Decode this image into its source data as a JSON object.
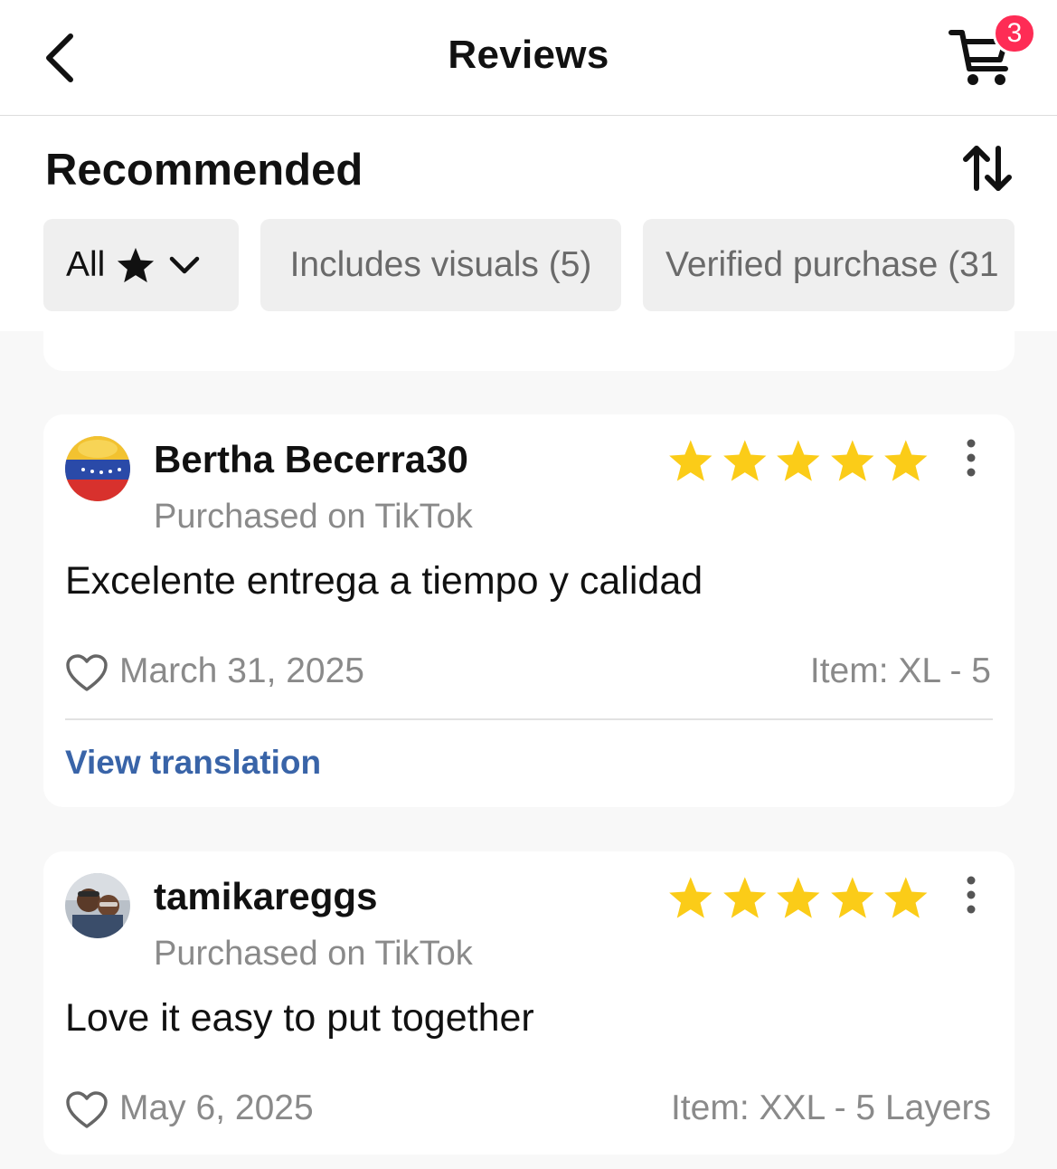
{
  "header": {
    "title": "Reviews",
    "cart_count": "3"
  },
  "sort": {
    "label": "Recommended"
  },
  "filters": {
    "all_label": "All",
    "visuals_label": "Includes visuals (5)",
    "verified_label": "Verified purchase (31"
  },
  "colors": {
    "star": "#fbcc18",
    "badge": "#fe2c55",
    "link": "#3964a8"
  },
  "reviews": [
    {
      "username": "Bertha Becerra30",
      "source": "Purchased on TikTok",
      "rating": 5,
      "text": "Excelente entrega a tiempo y calidad",
      "date": "March 31, 2025",
      "item": "Item: XL - 5",
      "translate_label": "View translation"
    },
    {
      "username": "tamikareggs",
      "source": "Purchased on TikTok",
      "rating": 5,
      "text": "Love it easy to put together",
      "date": "May 6, 2025",
      "item": "Item: XXL - 5 Layers"
    }
  ]
}
